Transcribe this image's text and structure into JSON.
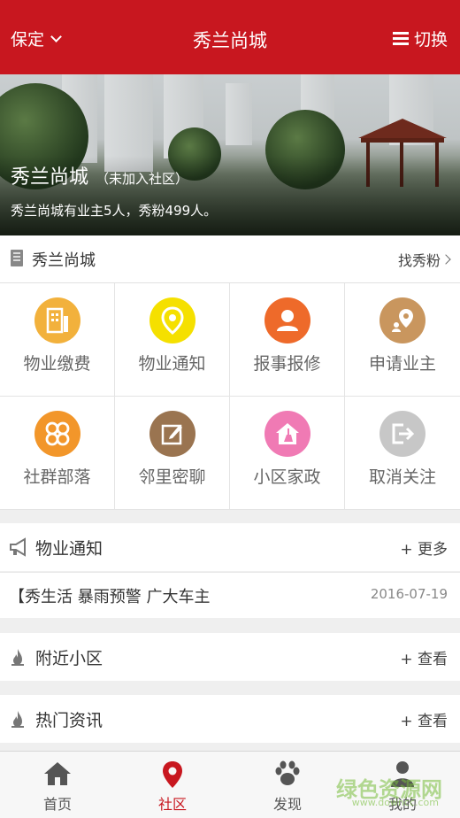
{
  "header": {
    "city": "保定",
    "title": "秀兰尚城",
    "switch_label": "切换",
    "bg_color": "#c8171f"
  },
  "banner": {
    "community_name": "秀兰尚城",
    "join_status": "（未加入社区）",
    "stats": "秀兰尚城有业主5人，秀粉499人。"
  },
  "community": {
    "name": "秀兰尚城",
    "find_fans": "找秀粉"
  },
  "services": [
    {
      "label": "物业缴费",
      "icon": "building-bill-icon",
      "color": "#f2b13c"
    },
    {
      "label": "物业通知",
      "icon": "location-pin-icon",
      "color": "#f5e000"
    },
    {
      "label": "报事报修",
      "icon": "user-icon",
      "color": "#ee6a2a"
    },
    {
      "label": "申请业主",
      "icon": "owner-location-icon",
      "color": "#c9965e"
    },
    {
      "label": "社群部落",
      "icon": "clover-icon",
      "color": "#f2962a"
    },
    {
      "label": "邻里密聊",
      "icon": "edit-icon",
      "color": "#9a7450"
    },
    {
      "label": "小区家政",
      "icon": "house-broom-icon",
      "color": "#f07ab4"
    },
    {
      "label": "取消关注",
      "icon": "exit-icon",
      "color": "#c7c7c7"
    }
  ],
  "notice": {
    "title": "物业通知",
    "more": "+ 更多",
    "item_text": "【秀生活 暴雨预警 广大车主",
    "item_date": "2016-07-19"
  },
  "nearby": {
    "title": "附近小区",
    "more": "+ 查看"
  },
  "hotnews": {
    "title": "热门资讯",
    "more": "+ 查看"
  },
  "tabs": [
    {
      "label": "首页",
      "icon": "home-icon"
    },
    {
      "label": "社区",
      "icon": "map-pin-icon",
      "active": true
    },
    {
      "label": "发现",
      "icon": "paw-icon"
    },
    {
      "label": "我的",
      "icon": "person-icon"
    }
  ],
  "watermark": {
    "text": "绿色资源网",
    "url": "www.downcc.com"
  }
}
